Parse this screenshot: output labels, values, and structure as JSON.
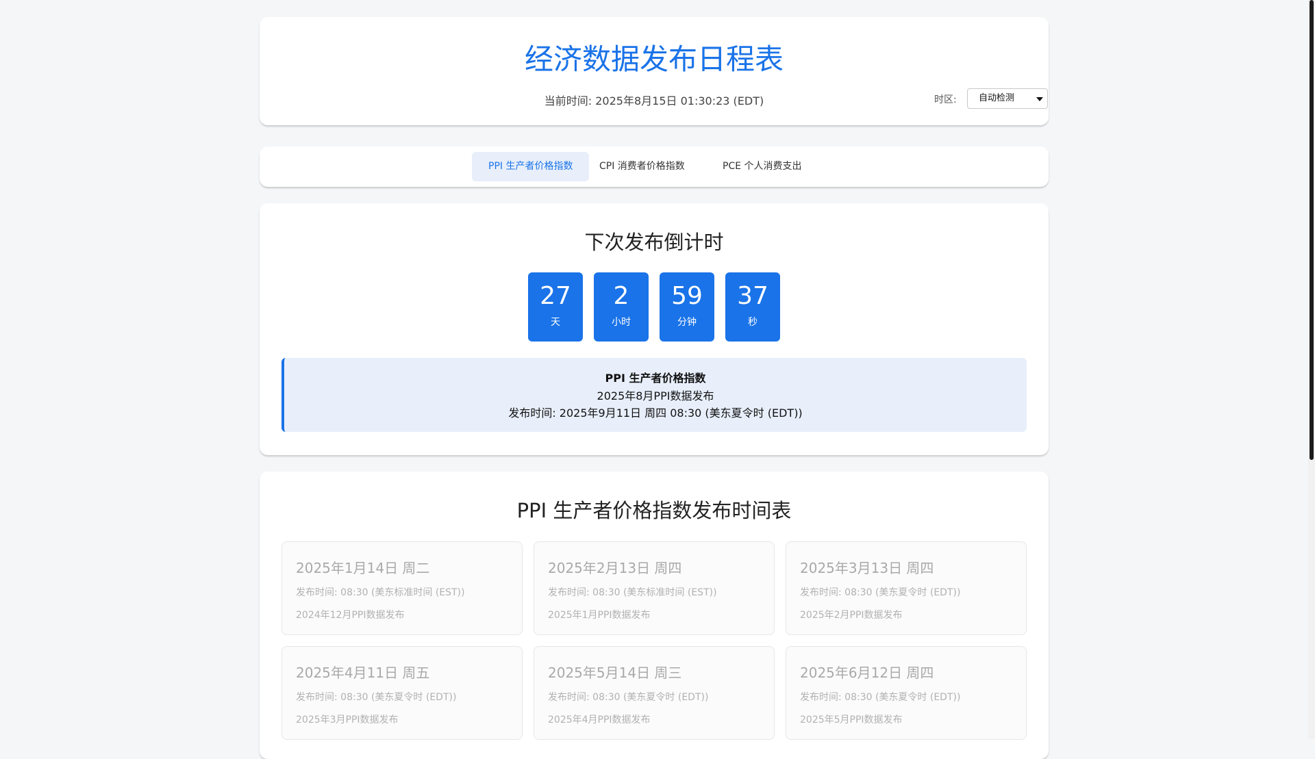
{
  "header": {
    "title": "经济数据发布日程表",
    "current_time": "当前时间: 2025年8月15日 01:30:23 (EDT)",
    "timezone_label": "时区:",
    "timezone_value": "自动检测"
  },
  "tabs": [
    {
      "label": "PPI 生产者价格指数",
      "active": true
    },
    {
      "label": "CPI 消费者价格指数",
      "active": false
    },
    {
      "label": "PCE 个人消费支出",
      "active": false
    }
  ],
  "countdown": {
    "title": "下次发布倒计时",
    "units": [
      {
        "value": "27",
        "unit": "天"
      },
      {
        "value": "2",
        "unit": "小时"
      },
      {
        "value": "59",
        "unit": "分钟"
      },
      {
        "value": "37",
        "unit": "秒"
      }
    ],
    "next_release": {
      "name": "PPI 生产者价格指数",
      "desc": "2025年8月PPI数据发布",
      "time": "发布时间: 2025年9月11日 周四 08:30 (美东夏令时 (EDT))"
    }
  },
  "schedule": {
    "title": "PPI 生产者价格指数发布时间表",
    "items": [
      {
        "date": "2025年1月14日 周二",
        "time": "发布时间: 08:30 (美东标准时间 (EST))",
        "desc": "2024年12月PPI数据发布"
      },
      {
        "date": "2025年2月13日 周四",
        "time": "发布时间: 08:30 (美东标准时间 (EST))",
        "desc": "2025年1月PPI数据发布"
      },
      {
        "date": "2025年3月13日 周四",
        "time": "发布时间: 08:30 (美东夏令时 (EDT))",
        "desc": "2025年2月PPI数据发布"
      },
      {
        "date": "2025年4月11日 周五",
        "time": "发布时间: 08:30 (美东夏令时 (EDT))",
        "desc": "2025年3月PPI数据发布"
      },
      {
        "date": "2025年5月14日 周三",
        "time": "发布时间: 08:30 (美东夏令时 (EDT))",
        "desc": "2025年4月PPI数据发布"
      },
      {
        "date": "2025年6月12日 周四",
        "time": "发布时间: 08:30 (美东夏令时 (EDT))",
        "desc": "2025年5月PPI数据发布"
      }
    ]
  },
  "colors": {
    "accent": "#1a73e8",
    "accent_light": "#e8effb",
    "background": "#f5f6f8"
  }
}
